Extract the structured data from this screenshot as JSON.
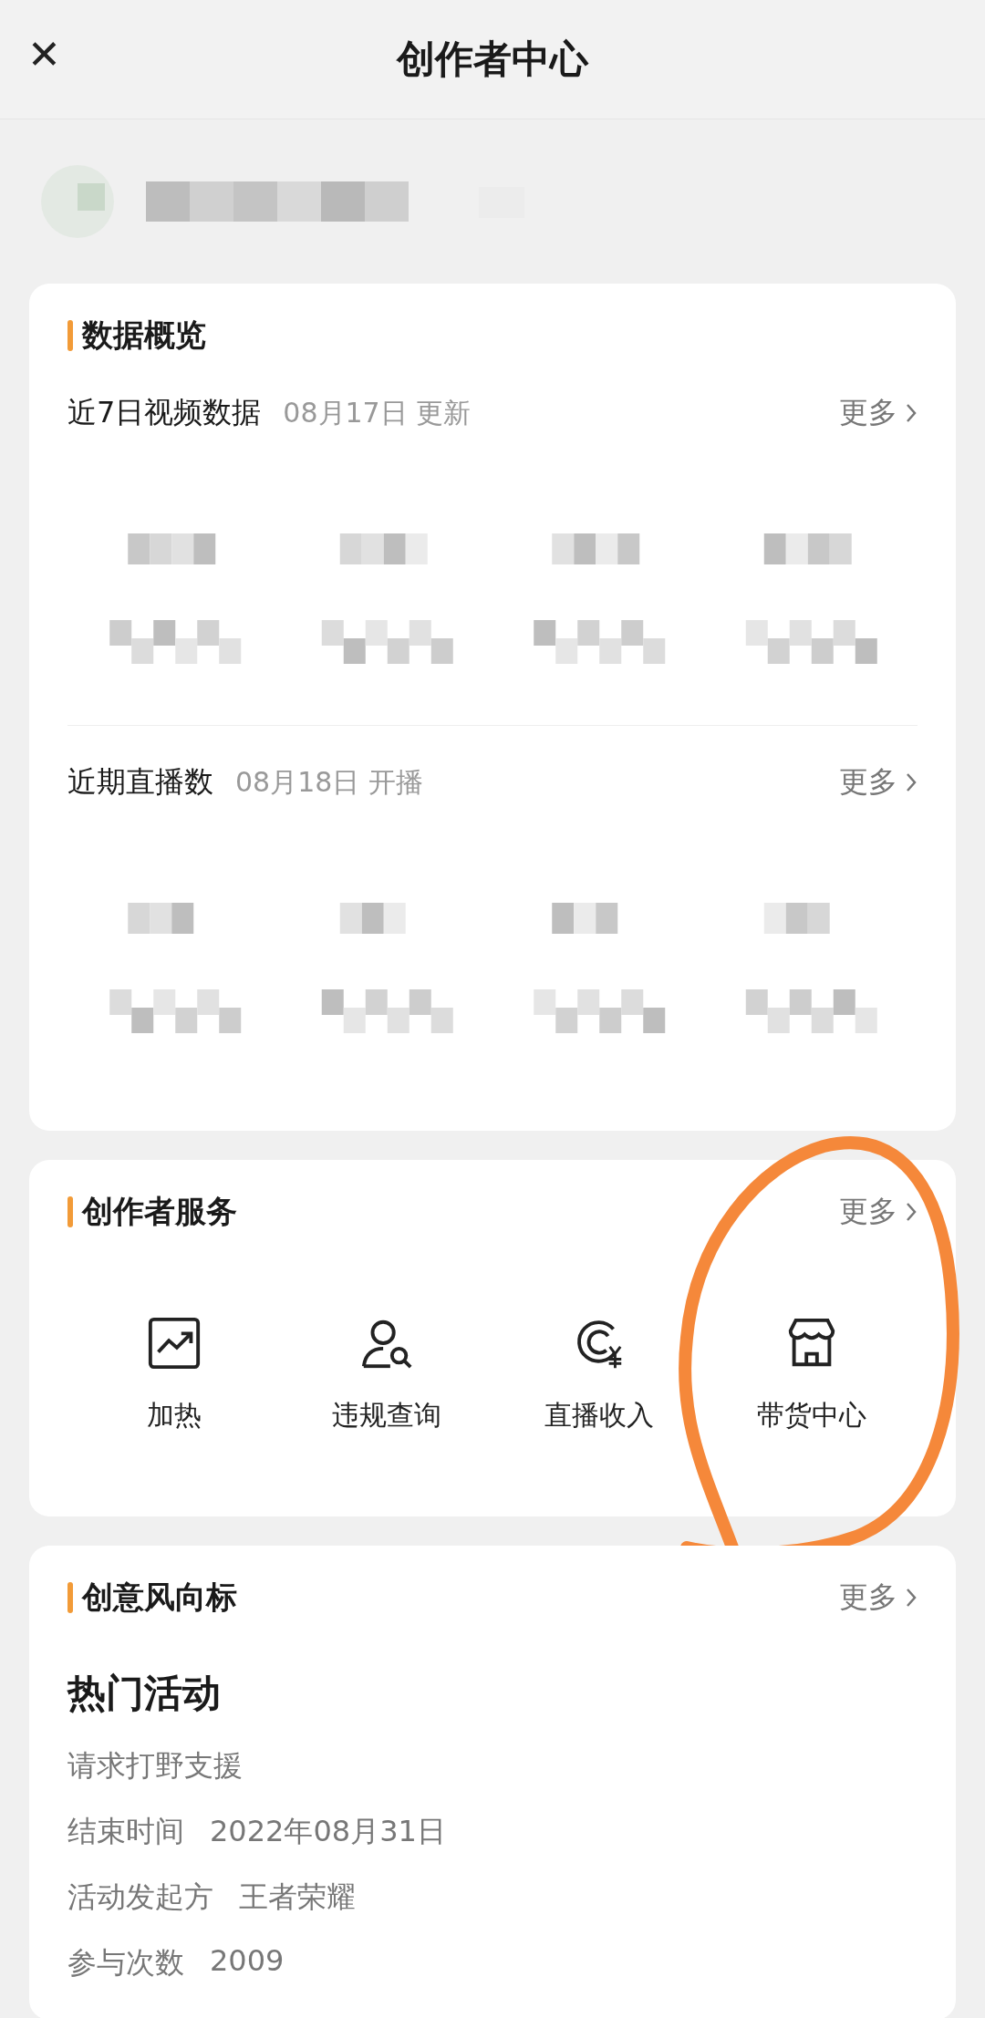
{
  "header": {
    "title": "创作者中心",
    "close_icon": "✕"
  },
  "overview": {
    "title": "数据概览",
    "sections": [
      {
        "label": "近7日视频数据",
        "note": "08月17日 更新",
        "more": "更多"
      },
      {
        "label": "近期直播数",
        "note": "08月18日 开播",
        "more": "更多"
      }
    ]
  },
  "services": {
    "title": "创作者服务",
    "more": "更多",
    "items": [
      {
        "kind": "chart",
        "label": "加热",
        "circled": false
      },
      {
        "kind": "person-search",
        "label": "违规查询",
        "circled": false
      },
      {
        "kind": "income",
        "label": "直播收入",
        "circled": false
      },
      {
        "kind": "store",
        "label": "带货中心",
        "circled": true
      }
    ]
  },
  "trends": {
    "title": "创意风向标",
    "more": "更多",
    "heading": "热门活动",
    "name": "请求打野支援",
    "fields": [
      {
        "label": "结束时间",
        "value": "2022年08月31日"
      },
      {
        "label": "活动发起方",
        "value": "王者荣耀"
      },
      {
        "label": "参与次数",
        "value": "2009"
      }
    ]
  }
}
